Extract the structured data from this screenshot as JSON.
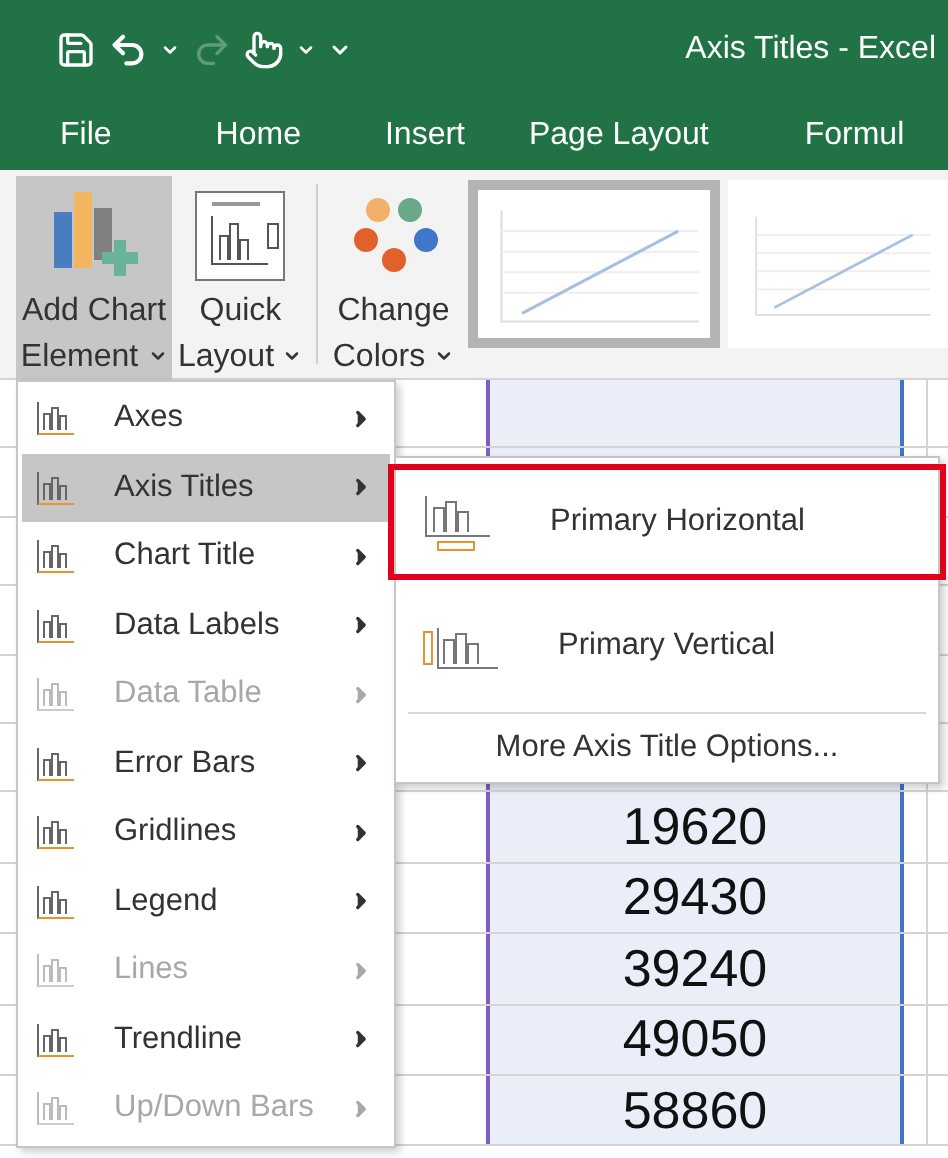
{
  "title_bar": {
    "title": "Axis Titles - Excel"
  },
  "ribbon_tabs": [
    {
      "label": "File"
    },
    {
      "label": "Home"
    },
    {
      "label": "Insert"
    },
    {
      "label": "Page Layout"
    },
    {
      "label": "Formul"
    }
  ],
  "ribbon": {
    "buttons": [
      {
        "kind": "add-element",
        "line1": "Add Chart",
        "line2": "Element",
        "pressed": true
      },
      {
        "kind": "layout",
        "line1": "Quick",
        "line2": "Layout",
        "pressed": false
      },
      {
        "kind": "colors",
        "line1": "Change",
        "line2": "Colors",
        "pressed": false
      }
    ],
    "chart_styles": [
      {
        "selected": true
      },
      {
        "selected": false
      }
    ]
  },
  "menu": {
    "items": [
      {
        "label": "Axes",
        "selected": false,
        "disabled": false
      },
      {
        "label": "Axis Titles",
        "selected": true,
        "disabled": false
      },
      {
        "label": "Chart Title",
        "selected": false,
        "disabled": false
      },
      {
        "label": "Data Labels",
        "selected": false,
        "disabled": false
      },
      {
        "label": "Data Table",
        "selected": false,
        "disabled": true
      },
      {
        "label": "Error Bars",
        "selected": false,
        "disabled": false
      },
      {
        "label": "Gridlines",
        "selected": false,
        "disabled": false
      },
      {
        "label": "Legend",
        "selected": false,
        "disabled": false
      },
      {
        "label": "Lines",
        "selected": false,
        "disabled": true
      },
      {
        "label": "Trendline",
        "selected": false,
        "disabled": false
      },
      {
        "label": "Up/Down Bars",
        "selected": false,
        "disabled": true
      }
    ]
  },
  "submenu": {
    "items": [
      {
        "kind": "horizontal",
        "label": "Primary Horizontal",
        "selected": true
      },
      {
        "kind": "vertical",
        "label": "Primary Vertical",
        "selected": false
      }
    ],
    "more_options": "More Axis Title Options..."
  },
  "sheet": {
    "values": [
      "19620",
      "29430",
      "39240",
      "49050",
      "58860"
    ]
  }
}
